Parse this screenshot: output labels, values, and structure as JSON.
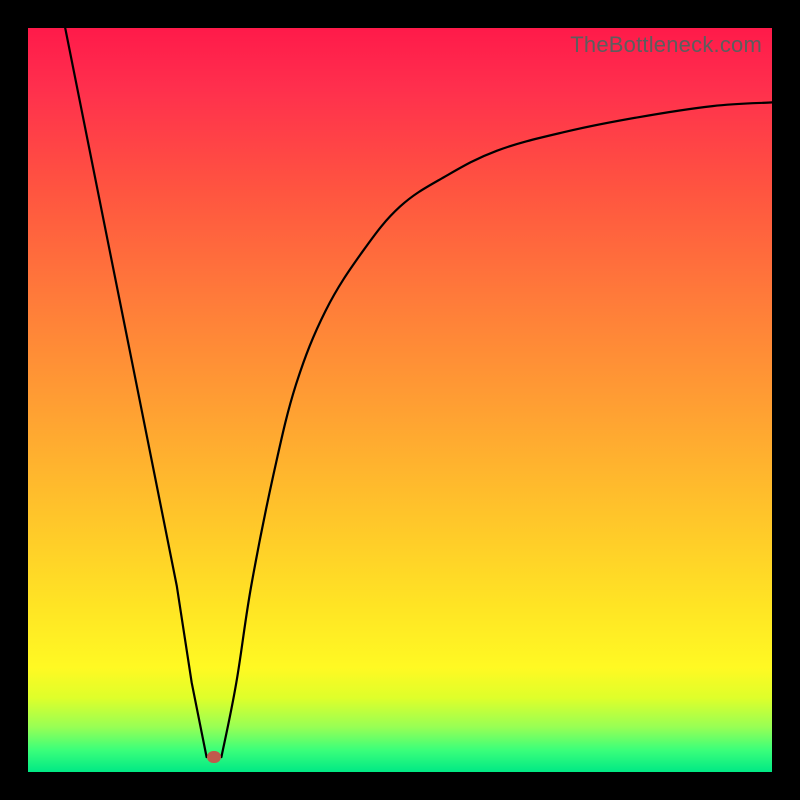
{
  "watermark": "TheBottleneck.com",
  "colors": {
    "frame": "#000000",
    "curve": "#000000",
    "marker": "#c15a4c",
    "gradient_stops": [
      "#ff1a4a",
      "#ff2f4d",
      "#ff5540",
      "#ff7a3a",
      "#ffa232",
      "#ffc62a",
      "#ffe524",
      "#fff923",
      "#dfff2a",
      "#97ff55",
      "#3cff7a",
      "#00e985"
    ]
  },
  "chart_data": {
    "type": "line",
    "title": "",
    "xlabel": "",
    "ylabel": "",
    "xlim": [
      0,
      100
    ],
    "ylim": [
      0,
      100
    ],
    "grid": false,
    "note": "Absorption/bottleneck-style V-curve. Left branch is nearly linear descending; right branch rises steeply then saturates toward ~90.",
    "minimum_marker": {
      "x": 25,
      "y": 2
    },
    "series": [
      {
        "name": "left-branch",
        "x": [
          5,
          8,
          11,
          14,
          17,
          20,
          22,
          24
        ],
        "y": [
          100,
          85,
          70,
          55,
          40,
          25,
          12,
          2
        ]
      },
      {
        "name": "right-branch",
        "x": [
          26,
          28,
          30,
          33,
          36,
          40,
          45,
          50,
          56,
          63,
          72,
          82,
          92,
          100
        ],
        "y": [
          2,
          12,
          25,
          40,
          52,
          62,
          70,
          76,
          80,
          83.5,
          86,
          88,
          89.5,
          90
        ]
      }
    ]
  }
}
